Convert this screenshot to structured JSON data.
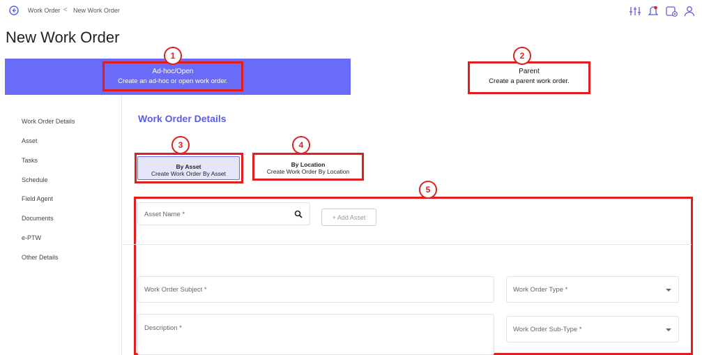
{
  "breadcrumb": {
    "root": "Work Order",
    "separator": "<",
    "current": "New Work Order"
  },
  "page_title": "New Work Order",
  "work_order_types": [
    {
      "title": "Ad-hoc/Open",
      "subtitle": "Create an ad-hoc or open work order.",
      "selected": true
    },
    {
      "title": "Parent",
      "subtitle": "Create a parent work order.",
      "selected": false
    }
  ],
  "annotations": [
    "1",
    "2",
    "3",
    "4",
    "5"
  ],
  "sidebar": {
    "items": [
      {
        "label": "Work Order Details"
      },
      {
        "label": "Asset"
      },
      {
        "label": "Tasks"
      },
      {
        "label": "Schedule"
      },
      {
        "label": "Field Agent"
      },
      {
        "label": "Documents"
      },
      {
        "label": "e-PTW"
      },
      {
        "label": "Other Details"
      }
    ]
  },
  "section": {
    "title": "Work Order Details"
  },
  "create_modes": [
    {
      "title": "By Asset",
      "subtitle": "Create Work Order By Asset",
      "selected": true
    },
    {
      "title": "By Location",
      "subtitle": "Create Work Order By Location",
      "selected": false
    }
  ],
  "form": {
    "asset_name_placeholder": "Asset Name *",
    "add_asset_label": "+ Add Asset",
    "subject_placeholder": "Work Order Subject *",
    "description_placeholder": "Description *",
    "type_placeholder": "Work Order Type *",
    "subtype_placeholder": "Work Order Sub-Type *"
  },
  "icons": [
    "back-circle-icon",
    "filter-sliders-icon",
    "alarm-icon",
    "calendar-clock-icon",
    "user-icon",
    "search-icon"
  ],
  "colors": {
    "accent": "#6a6cf7",
    "annotation_red": "#e01e1e",
    "section_title": "#5a5de6"
  }
}
